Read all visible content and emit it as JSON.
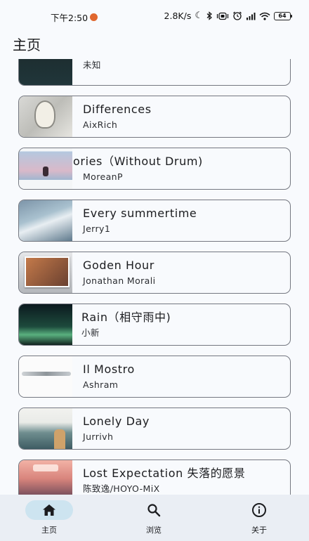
{
  "status_bar": {
    "time": "下午2:50",
    "network_speed": "2.8K/s",
    "battery": "64",
    "icons": [
      "notification-icon",
      "moon-icon",
      "bluetooth-icon",
      "vibrate-icon",
      "alarm-icon",
      "signal-icon",
      "wifi-icon",
      "battery-icon"
    ]
  },
  "header": {
    "title": "主页"
  },
  "songs": [
    {
      "title": "",
      "artist": "未知"
    },
    {
      "title": "Differences",
      "artist": "AixRich"
    },
    {
      "title": "ories（Without Drum)",
      "artist": "MoreanP"
    },
    {
      "title": "Every summertime",
      "artist": "Jerry1"
    },
    {
      "title": "Goden Hour",
      "artist": "Jonathan Morali"
    },
    {
      "title": "Rain（相守雨中)",
      "artist": "小新"
    },
    {
      "title": "Il Mostro",
      "artist": "Ashram"
    },
    {
      "title": "Lonely Day",
      "artist": "Jurrivh"
    },
    {
      "title": "Lost Expectation 失落的愿景",
      "artist": "陈致逸/HOYO-MiX"
    }
  ],
  "bottom_nav": {
    "home": "主页",
    "browse": "浏览",
    "about": "关于"
  },
  "colors": {
    "background": "#f8fafd",
    "nav_background": "#eaeef4",
    "nav_active_pill": "#cde4f0",
    "card_border": "#747780"
  }
}
